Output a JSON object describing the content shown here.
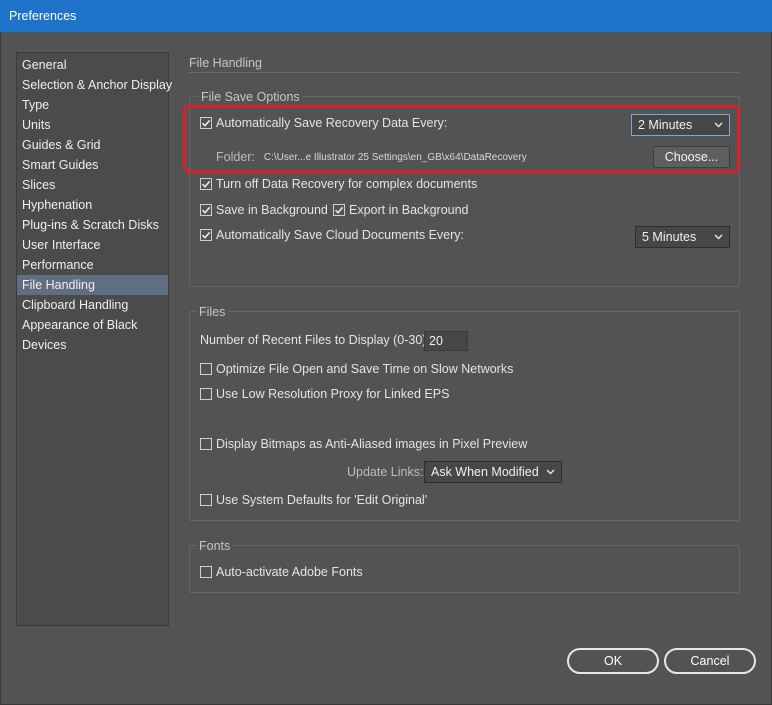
{
  "window": {
    "title": "Preferences"
  },
  "sidebar": {
    "items": [
      {
        "label": "General"
      },
      {
        "label": "Selection & Anchor Display"
      },
      {
        "label": "Type"
      },
      {
        "label": "Units"
      },
      {
        "label": "Guides & Grid"
      },
      {
        "label": "Smart Guides"
      },
      {
        "label": "Slices"
      },
      {
        "label": "Hyphenation"
      },
      {
        "label": "Plug-ins & Scratch Disks"
      },
      {
        "label": "User Interface"
      },
      {
        "label": "Performance"
      },
      {
        "label": "File Handling",
        "selected": true
      },
      {
        "label": "Clipboard Handling"
      },
      {
        "label": "Appearance of Black"
      },
      {
        "label": "Devices"
      }
    ]
  },
  "main": {
    "section_title": "File Handling",
    "file_save": {
      "title": "File Save Options",
      "auto_save_recovery": {
        "label": "Automatically Save Recovery Data Every:",
        "checked": true,
        "interval": "2 Minutes"
      },
      "folder_label": "Folder:",
      "folder_path": "C:\\User...e Illustrator 25 Settings\\en_GB\\x64\\DataRecovery",
      "choose_label": "Choose...",
      "turn_off_recovery": {
        "label": "Turn off Data Recovery for complex documents",
        "checked": true
      },
      "save_in_background": {
        "label": "Save in Background",
        "checked": true
      },
      "export_in_background": {
        "label": "Export in Background",
        "checked": true
      },
      "auto_save_cloud": {
        "label": "Automatically Save Cloud Documents Every:",
        "checked": true,
        "interval": "5 Minutes"
      }
    },
    "files": {
      "title": "Files",
      "recent_files_label": "Number of Recent Files to Display (0-30):",
      "recent_files_value": "20",
      "optimize_open_save": {
        "label": "Optimize File Open and Save Time on Slow Networks",
        "checked": false
      },
      "low_res_proxy": {
        "label": "Use Low Resolution Proxy for Linked EPS",
        "checked": false
      },
      "display_bitmaps": {
        "label": "Display Bitmaps as Anti-Aliased images in Pixel Preview",
        "checked": false
      },
      "update_links_label": "Update Links:",
      "update_links_value": "Ask When Modified",
      "system_defaults": {
        "label": "Use System Defaults for 'Edit Original'",
        "checked": false
      }
    },
    "fonts": {
      "title": "Fonts",
      "auto_activate": {
        "label": "Auto-activate Adobe Fonts",
        "checked": false
      }
    }
  },
  "footer": {
    "ok_label": "OK",
    "cancel_label": "Cancel"
  },
  "colors": {
    "titlebar": "#1e73c8",
    "background": "#535353",
    "selected": "#5f6e83",
    "highlight": "#d9202b"
  },
  "icons": {
    "checkbox_checked": "checkmark-icon",
    "dropdown": "chevron-down-icon"
  }
}
